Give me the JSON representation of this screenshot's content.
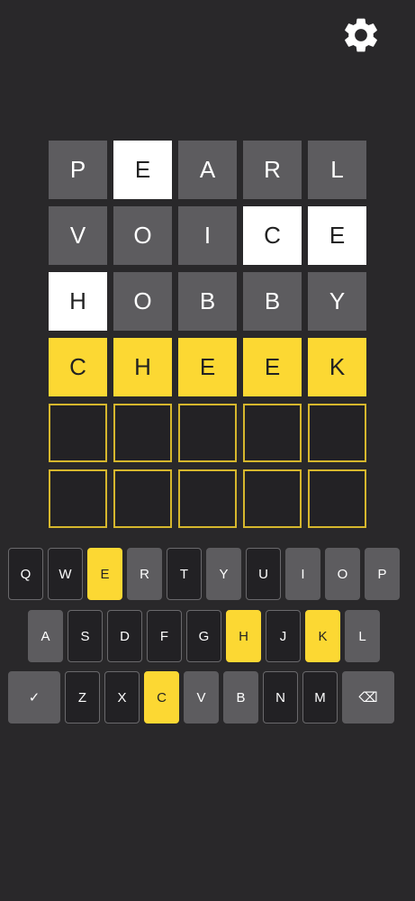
{
  "settings": {
    "icon": "gear-icon"
  },
  "board": {
    "rows": [
      [
        {
          "letter": "P",
          "state": "absent"
        },
        {
          "letter": "E",
          "state": "present"
        },
        {
          "letter": "A",
          "state": "absent"
        },
        {
          "letter": "R",
          "state": "absent"
        },
        {
          "letter": "L",
          "state": "absent"
        }
      ],
      [
        {
          "letter": "V",
          "state": "absent"
        },
        {
          "letter": "O",
          "state": "absent"
        },
        {
          "letter": "I",
          "state": "absent"
        },
        {
          "letter": "C",
          "state": "present"
        },
        {
          "letter": "E",
          "state": "present"
        }
      ],
      [
        {
          "letter": "H",
          "state": "present"
        },
        {
          "letter": "O",
          "state": "absent"
        },
        {
          "letter": "B",
          "state": "absent"
        },
        {
          "letter": "B",
          "state": "absent"
        },
        {
          "letter": "Y",
          "state": "absent"
        }
      ],
      [
        {
          "letter": "C",
          "state": "correct"
        },
        {
          "letter": "H",
          "state": "correct"
        },
        {
          "letter": "E",
          "state": "correct"
        },
        {
          "letter": "E",
          "state": "correct"
        },
        {
          "letter": "K",
          "state": "correct"
        }
      ],
      [
        {
          "letter": "",
          "state": "empty"
        },
        {
          "letter": "",
          "state": "empty"
        },
        {
          "letter": "",
          "state": "empty"
        },
        {
          "letter": "",
          "state": "empty"
        },
        {
          "letter": "",
          "state": "empty"
        }
      ],
      [
        {
          "letter": "",
          "state": "empty"
        },
        {
          "letter": "",
          "state": "empty"
        },
        {
          "letter": "",
          "state": "empty"
        },
        {
          "letter": "",
          "state": "empty"
        },
        {
          "letter": "",
          "state": "empty"
        }
      ]
    ]
  },
  "keyboard": {
    "rows": [
      [
        {
          "key": "Q",
          "state": "unused"
        },
        {
          "key": "W",
          "state": "unused"
        },
        {
          "key": "E",
          "state": "correct"
        },
        {
          "key": "R",
          "state": "absent"
        },
        {
          "key": "T",
          "state": "unused"
        },
        {
          "key": "Y",
          "state": "absent"
        },
        {
          "key": "U",
          "state": "unused"
        },
        {
          "key": "I",
          "state": "absent"
        },
        {
          "key": "O",
          "state": "absent"
        },
        {
          "key": "P",
          "state": "absent"
        }
      ],
      [
        {
          "key": "A",
          "state": "absent"
        },
        {
          "key": "S",
          "state": "unused"
        },
        {
          "key": "D",
          "state": "unused"
        },
        {
          "key": "F",
          "state": "unused"
        },
        {
          "key": "G",
          "state": "unused"
        },
        {
          "key": "H",
          "state": "correct"
        },
        {
          "key": "J",
          "state": "unused"
        },
        {
          "key": "K",
          "state": "correct"
        },
        {
          "key": "L",
          "state": "absent"
        }
      ],
      [
        {
          "key": "✓",
          "state": "wide",
          "name": "enter-key"
        },
        {
          "key": "Z",
          "state": "unused"
        },
        {
          "key": "X",
          "state": "unused"
        },
        {
          "key": "C",
          "state": "correct"
        },
        {
          "key": "V",
          "state": "absent"
        },
        {
          "key": "B",
          "state": "absent"
        },
        {
          "key": "N",
          "state": "unused"
        },
        {
          "key": "M",
          "state": "unused"
        },
        {
          "key": "⌫",
          "state": "wide",
          "name": "backspace-key"
        }
      ]
    ]
  },
  "colors": {
    "background": "#29282a",
    "absent": "#5d5c5f",
    "present": "#ffffff",
    "correct": "#fcd833",
    "empty_border": "#d6b72d"
  }
}
